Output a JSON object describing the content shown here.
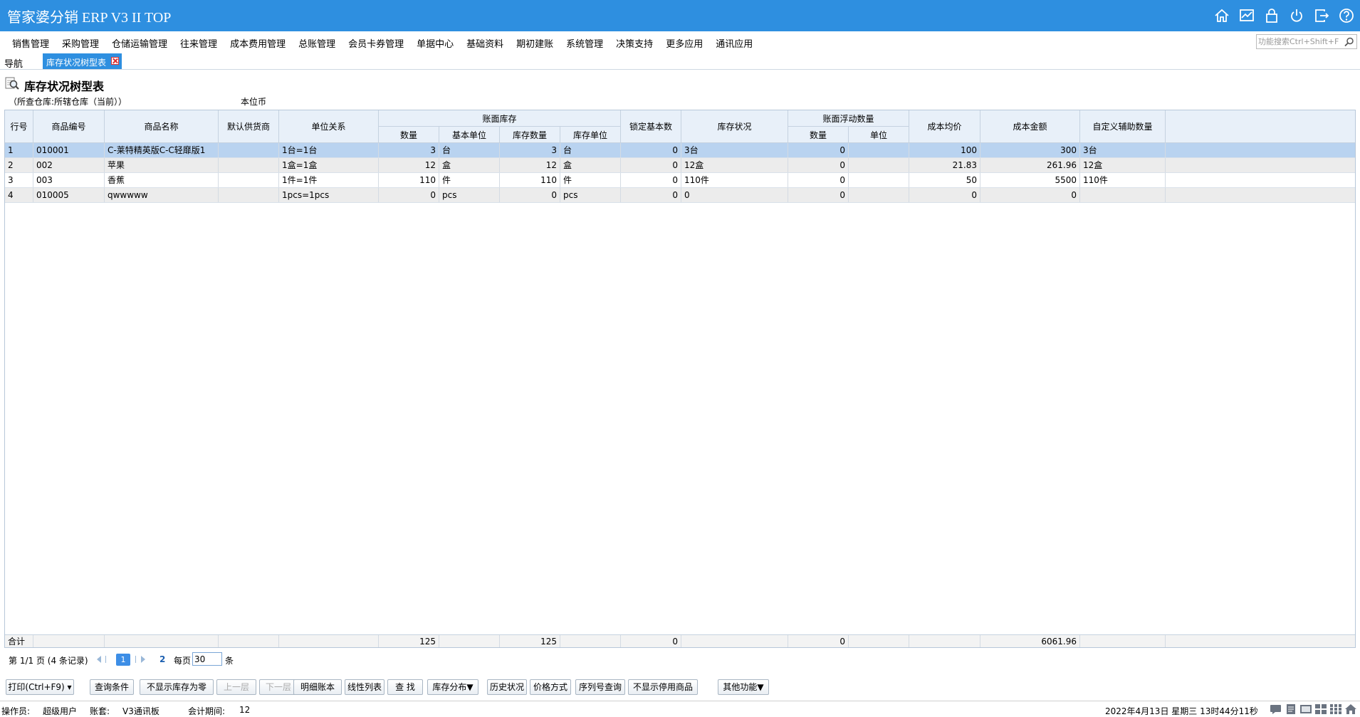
{
  "app": {
    "title": "管家婆分销 ERP V3 II TOP"
  },
  "menu": [
    "销售管理",
    "采购管理",
    "仓储运输管理",
    "往来管理",
    "成本费用管理",
    "总账管理",
    "会员卡券管理",
    "单据中心",
    "基础资料",
    "期初建账",
    "系统管理",
    "决策支持",
    "更多应用",
    "通讯应用"
  ],
  "search": {
    "placeholder": "功能搜索Ctrl+Shift+F"
  },
  "tabs": {
    "nav": "导航",
    "active": "库存状况树型表"
  },
  "report": {
    "title": "库存状况树型表",
    "filter": "（所查仓库:所辖仓库（当前））",
    "currency": "本位币"
  },
  "table": {
    "headers": {
      "row_no": "行号",
      "code": "商品编号",
      "name": "商品名称",
      "supplier": "默认供货商",
      "unit_rel": "单位关系",
      "book_stock": "账面库存",
      "qty": "数量",
      "base_unit": "基本单位",
      "stock_qty": "库存数量",
      "stock_unit": "库存单位",
      "locked": "锁定基本数",
      "status": "库存状况",
      "float_qty": "账面浮动数量",
      "float_num": "数量",
      "float_unit": "单位",
      "avg_cost": "成本均价",
      "cost_amount": "成本金额",
      "custom_qty": "自定义辅助数量"
    },
    "rows": [
      {
        "row_no": "1",
        "code": "010001",
        "name": "C-莱特精英版C-C轻靡版1",
        "supplier": "",
        "unit_rel": "1台=1台",
        "qty": "3",
        "base_unit": "台",
        "stock_qty": "3",
        "stock_unit": "台",
        "locked": "0",
        "status": "3台",
        "float_num": "0",
        "float_unit": "",
        "avg_cost": "100",
        "cost_amount": "300",
        "custom_qty": "3台"
      },
      {
        "row_no": "2",
        "code": "002",
        "name": "苹果",
        "supplier": "",
        "unit_rel": "1盒=1盒",
        "qty": "12",
        "base_unit": "盒",
        "stock_qty": "12",
        "stock_unit": "盒",
        "locked": "0",
        "status": "12盒",
        "float_num": "0",
        "float_unit": "",
        "avg_cost": "21.83",
        "cost_amount": "261.96",
        "custom_qty": "12盒"
      },
      {
        "row_no": "3",
        "code": "003",
        "name": "香蕉",
        "supplier": "",
        "unit_rel": "1件=1件",
        "qty": "110",
        "base_unit": "件",
        "stock_qty": "110",
        "stock_unit": "件",
        "locked": "0",
        "status": "110件",
        "float_num": "0",
        "float_unit": "",
        "avg_cost": "50",
        "cost_amount": "5500",
        "custom_qty": "110件"
      },
      {
        "row_no": "4",
        "code": "010005",
        "name": "qwwwww",
        "supplier": "",
        "unit_rel": "1pcs=1pcs",
        "qty": "0",
        "base_unit": "pcs",
        "stock_qty": "0",
        "stock_unit": "pcs",
        "locked": "0",
        "status": "0",
        "float_num": "0",
        "float_unit": "",
        "avg_cost": "0",
        "cost_amount": "0",
        "custom_qty": ""
      }
    ],
    "summary": {
      "label": "合计",
      "qty": "125",
      "stock_qty": "125",
      "locked": "0",
      "float_num": "0",
      "cost_amount": "6061.96"
    }
  },
  "pager": {
    "info": "第 1/1 页 (4 条记录)",
    "current": "1",
    "total": "2",
    "per_page_label": "每页",
    "page_size": "30",
    "unit": "条"
  },
  "buttons": [
    {
      "label": "打印(Ctrl+F9) ▾",
      "enabled": true
    },
    {
      "label": "查询条件",
      "enabled": true
    },
    {
      "label": "不显示库存为零",
      "enabled": true
    },
    {
      "label": "上一层",
      "enabled": false
    },
    {
      "label": "下一层",
      "enabled": false
    },
    {
      "label": "明细账本",
      "enabled": true
    },
    {
      "label": "线性列表",
      "enabled": true
    },
    {
      "label": "查 找",
      "enabled": true
    },
    {
      "label": "库存分布▼",
      "enabled": true
    },
    {
      "label": "历史状况",
      "enabled": true
    },
    {
      "label": "价格方式",
      "enabled": true
    },
    {
      "label": "序列号查询",
      "enabled": true
    },
    {
      "label": "不显示停用商品",
      "enabled": true
    },
    {
      "label": "其他功能▼",
      "enabled": true
    }
  ],
  "status": {
    "operator_label": "操作员:",
    "operator": "超级用户",
    "account_label": "账套:",
    "account": "V3通讯板",
    "period_label": "会计期间:",
    "period": "12",
    "datetime": "2022年4月13日  星期三  13时44分11秒"
  },
  "icons": {
    "title": [
      "home-icon",
      "chart-icon",
      "lock-icon",
      "power-icon",
      "exit-icon",
      "help-icon"
    ],
    "status": [
      "message-icon",
      "document-icon",
      "screen-icon",
      "grid-icon",
      "apps-icon",
      "home-small-icon"
    ]
  },
  "colors": {
    "title_bar": "#2e8fe0",
    "selected_row": "#b9d3f0",
    "header_bg": "#e8f0f9"
  }
}
